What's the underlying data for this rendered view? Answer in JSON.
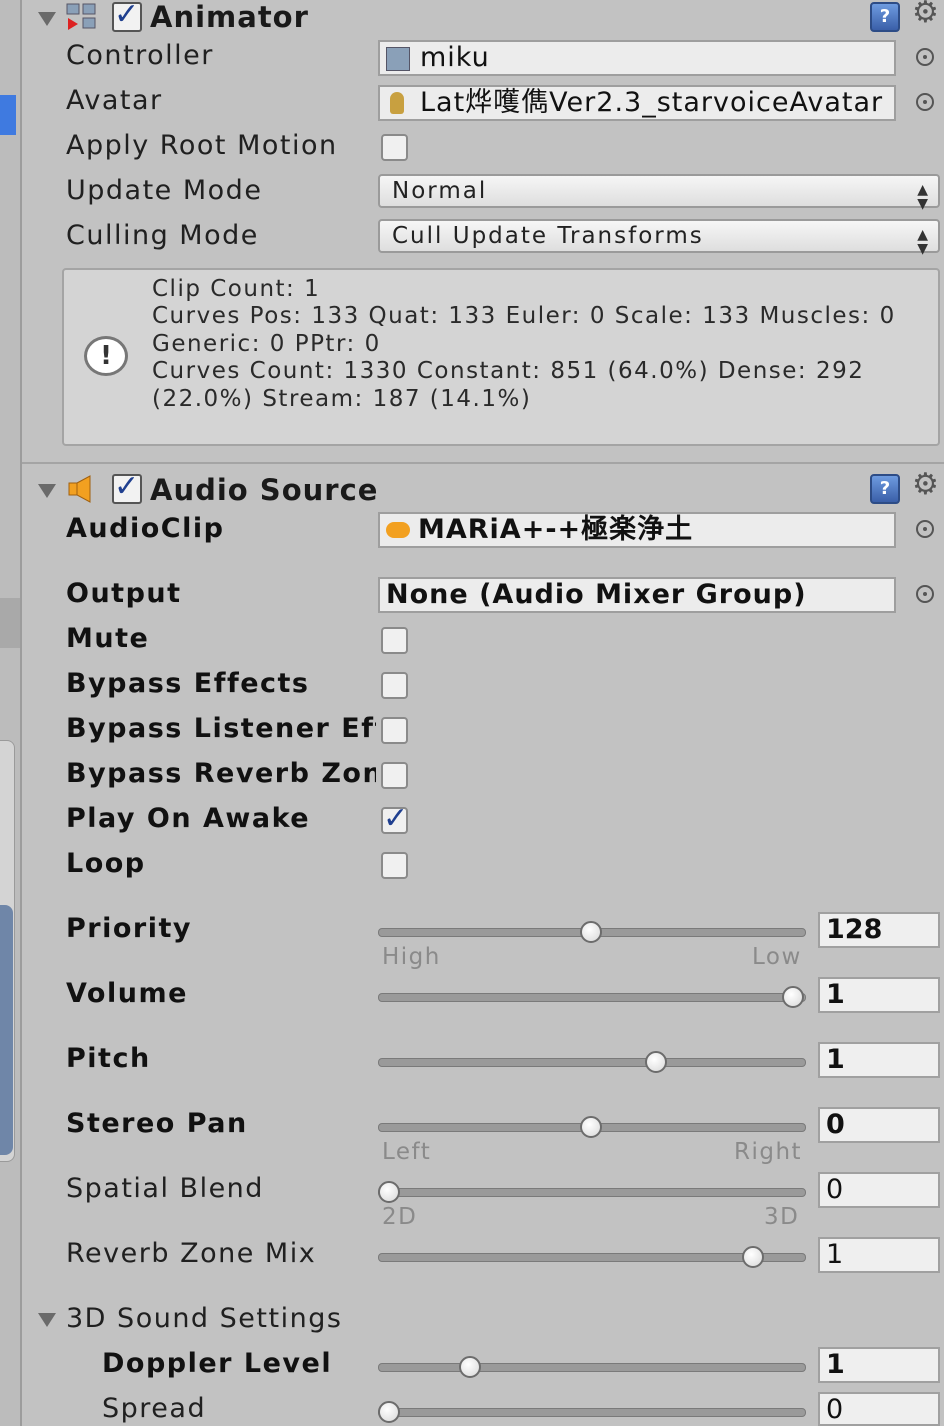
{
  "animator": {
    "title": "Animator",
    "enabled": true,
    "controller": {
      "label": "Controller",
      "value": "miku"
    },
    "avatar": {
      "label": "Avatar",
      "value": "Lat烨嚄儁Ver2.3_starvoiceAvatar"
    },
    "apply_root_motion": {
      "label": "Apply Root Motion",
      "checked": false
    },
    "update_mode": {
      "label": "Update Mode",
      "value": "Normal"
    },
    "culling_mode": {
      "label": "Culling Mode",
      "value": "Cull Update Transforms"
    },
    "info": {
      "lines": [
        "Clip Count: 1",
        "Curves Pos: 133 Quat: 133 Euler: 0 Scale: 133 Muscles: 0",
        "Generic: 0 PPtr: 0",
        "Curves Count: 1330 Constant: 851 (64.0%) Dense: 292",
        "(22.0%) Stream: 187 (14.1%)"
      ]
    }
  },
  "audio_source": {
    "title": "Audio Source",
    "enabled": true,
    "audioclip": {
      "label": "AudioClip",
      "value": "MARiA+-+極楽浄土"
    },
    "output": {
      "label": "Output",
      "value": "None (Audio Mixer Group)"
    },
    "toggles": [
      {
        "label": "Mute",
        "checked": false
      },
      {
        "label": "Bypass Effects",
        "checked": false
      },
      {
        "label": "Bypass Listener Eff",
        "checked": false
      },
      {
        "label": "Bypass Reverb Zon",
        "checked": false
      },
      {
        "label": "Play On Awake",
        "checked": true
      },
      {
        "label": "Loop",
        "checked": false
      }
    ],
    "priority": {
      "label": "Priority",
      "value": "128",
      "min_label": "High",
      "max_label": "Low",
      "fraction": 0.5
    },
    "volume": {
      "label": "Volume",
      "value": "1",
      "fraction": 1.0
    },
    "pitch": {
      "label": "Pitch",
      "value": "1",
      "fraction": 0.66
    },
    "stereo_pan": {
      "label": "Stereo Pan",
      "value": "0",
      "min_label": "Left",
      "max_label": "Right",
      "fraction": 0.5
    },
    "spatial_blend": {
      "label": "Spatial Blend",
      "value": "0",
      "min_label": "2D",
      "max_label": "3D",
      "fraction": 0.0
    },
    "reverb_zone_mix": {
      "label": "Reverb Zone Mix",
      "value": "1",
      "fraction": 0.9
    },
    "sound_3d": {
      "label": "3D Sound Settings",
      "doppler_level": {
        "label": "Doppler Level",
        "value": "1",
        "fraction": 0.2
      },
      "spread": {
        "label": "Spread",
        "value": "0",
        "fraction": 0.0
      }
    }
  },
  "icons": {
    "foldout": "triangle-down",
    "help": "help-book",
    "settings": "gear",
    "target": "object-picker",
    "info": "exclamation-bubble",
    "animator": "animator-component",
    "audio": "speaker"
  },
  "colors": {
    "panel": "#c2c2c2",
    "accent": "#3f7ae0",
    "check": "#1f3f8f"
  }
}
